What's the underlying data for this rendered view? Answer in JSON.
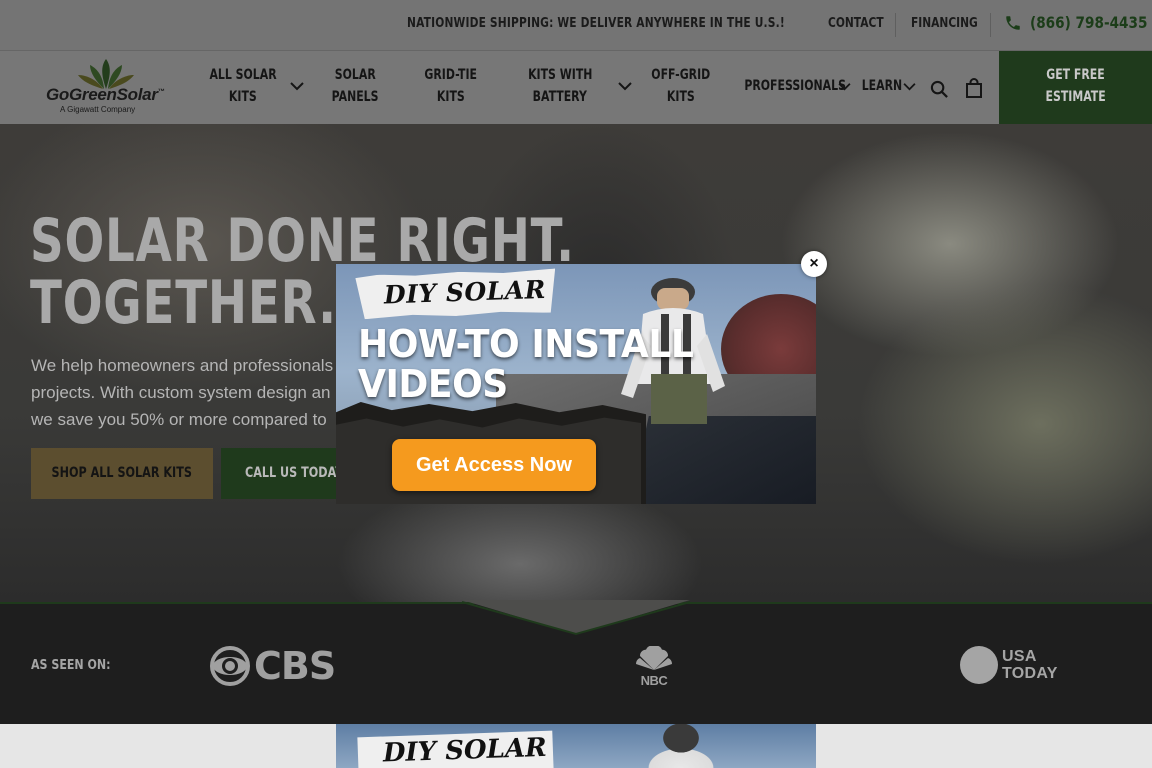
{
  "topbar": {
    "shipping": "NATIONWIDE SHIPPING: WE DELIVER ANYWHERE IN THE U.S.!",
    "contact": "CONTACT",
    "financing": "FINANCING",
    "phone": "(866) 798-4435"
  },
  "logo": {
    "name": "GoGreenSolar",
    "tm": "™",
    "tagline": "A Gigawatt Company"
  },
  "nav": {
    "all_solar_kits_1": "ALL SOLAR",
    "all_solar_kits_2": "KITS",
    "solar_panels_1": "SOLAR",
    "solar_panels_2": "PANELS",
    "grid_tie_1": "GRID-TIE",
    "grid_tie_2": "KITS",
    "battery_1": "KITS WITH",
    "battery_2": "BATTERY",
    "off_grid_1": "OFF-GRID",
    "off_grid_2": "KITS",
    "professionals": "PROFESSIONALS",
    "learn": "LEARN",
    "estimate_1": "GET FREE",
    "estimate_2": "ESTIMATE"
  },
  "hero": {
    "title_line1": "SOLAR DONE RIGHT.",
    "title_line2": "TOGETHER.",
    "para_line1": "We help homeowners and professionals",
    "para_line2": "projects. With custom system design an",
    "para_line3": "we save you 50% or more compared to",
    "shop_button": "SHOP ALL SOLAR KITS",
    "call_button": "CALL US TODAY"
  },
  "seen_on": {
    "label": "AS SEEN ON:",
    "cbs": "CBS",
    "nbc": "NBC",
    "usa_line1": "USA",
    "usa_line2": "TODAY"
  },
  "popup": {
    "tag": "DIY SOLAR",
    "headline_line1": "HOW-TO INSTALL",
    "headline_line2": "VIDEOS",
    "cta": "Get Access Now",
    "close": "×"
  },
  "bottom_thumb": {
    "tag": "DIY SOLAR"
  },
  "colors": {
    "brand_green": "#1f3a1c",
    "cta_orange": "#f59a1e",
    "shop_gold": "#5c4e2f"
  }
}
